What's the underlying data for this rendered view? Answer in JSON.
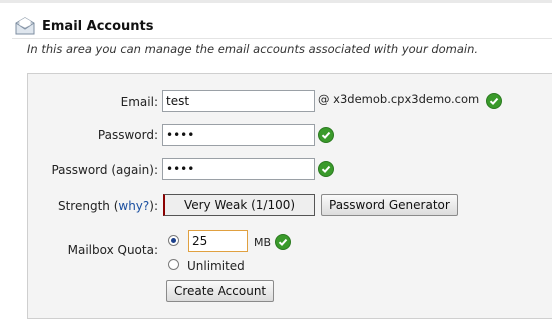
{
  "header": {
    "title": "Email Accounts",
    "subtitle": "In this area you can manage the email accounts associated with your domain."
  },
  "form": {
    "email_label": "Email:",
    "email_value": "test",
    "domain_text": "@ x3demob.cpx3demo.com",
    "password_label": "Password:",
    "password_value": "••••",
    "password_again_label": "Password (again):",
    "password_again_value": "••••",
    "strength_label_prefix": "Strength (",
    "strength_why": "why?",
    "strength_label_suffix": "):",
    "strength_value": "Very Weak (1/100)",
    "password_generator_label": "Password Generator",
    "quota_label": "Mailbox Quota:",
    "quota_value": "25",
    "quota_unit": "MB",
    "quota_option_selected": "limited",
    "unlimited_label": "Unlimited",
    "create_button_label": "Create Account"
  },
  "colors": {
    "check_green": "#3a9a2b",
    "strength_bar_accent": "#8b0000",
    "link_blue": "#1a4fa0",
    "quota_input_border": "#e0a040"
  },
  "icons": [
    "envelope-icon",
    "check-icon"
  ]
}
